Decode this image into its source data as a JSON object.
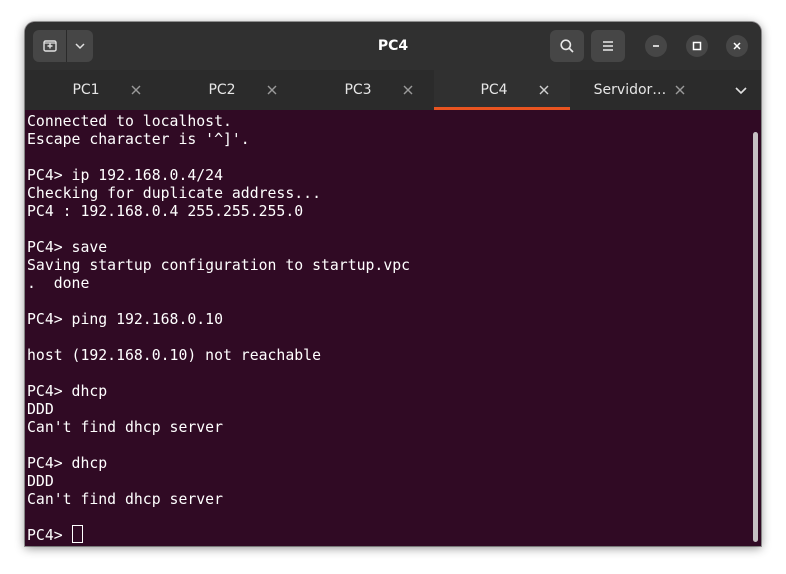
{
  "window": {
    "title": "PC4"
  },
  "tabs": [
    {
      "label": "PC1",
      "active": false
    },
    {
      "label": "PC2",
      "active": false
    },
    {
      "label": "PC3",
      "active": false
    },
    {
      "label": "PC4",
      "active": true
    },
    {
      "label": "Servidor…",
      "active": false
    }
  ],
  "icons": {
    "new_tab": "new-tab-icon",
    "dropdown": "chevron-down-icon",
    "search": "search-icon",
    "menu": "hamburger-menu-icon",
    "minimize": "minimize-icon",
    "maximize": "maximize-icon",
    "close": "close-icon",
    "tab_close": "close-icon",
    "tab_list": "chevron-down-icon"
  },
  "colors": {
    "terminal_bg": "#300a24",
    "active_tab_accent": "#e95420",
    "headerbar": "#303030"
  },
  "terminal": {
    "lines": [
      "Connected to localhost.",
      "Escape character is '^]'.",
      "",
      "PC4> ip 192.168.0.4/24",
      "Checking for duplicate address...",
      "PC4 : 192.168.0.4 255.255.255.0",
      "",
      "PC4> save",
      "Saving startup configuration to startup.vpc",
      ".  done",
      "",
      "PC4> ping 192.168.0.10",
      "",
      "host (192.168.0.10) not reachable",
      "",
      "PC4> dhcp",
      "DDD",
      "Can't find dhcp server",
      "",
      "PC4> dhcp",
      "DDD",
      "Can't find dhcp server",
      "",
      "PC4> "
    ]
  }
}
